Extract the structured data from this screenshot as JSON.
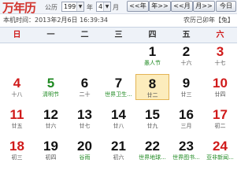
{
  "header": {
    "logo": "万年历",
    "calendar_type_label": "公历",
    "year_value": "1999",
    "year_unit": "年",
    "month_value": "4",
    "month_unit": "月",
    "prev_year_label": "<<年",
    "next_year_label": "年>>",
    "prev_month_label": "<<月",
    "next_month_label": "月>>",
    "today_label": "今日"
  },
  "info": {
    "local_time": "本机时间：2013年2月6日 16:39:34",
    "lunar_year": "农历己卯年【兔】"
  },
  "weekdays": [
    "日",
    "一",
    "二",
    "三",
    "四",
    "五",
    "六"
  ],
  "days": [
    {
      "n": "",
      "s": ""
    },
    {
      "n": "",
      "s": ""
    },
    {
      "n": "",
      "s": ""
    },
    {
      "n": "",
      "s": ""
    },
    {
      "n": "1",
      "s": "愚人节"
    },
    {
      "n": "2",
      "s": "十六"
    },
    {
      "n": "3",
      "s": "十七"
    },
    {
      "n": "4",
      "s": "十八"
    },
    {
      "n": "5",
      "s": "清明节"
    },
    {
      "n": "6",
      "s": "二十"
    },
    {
      "n": "7",
      "s": "世界卫生..."
    },
    {
      "n": "8",
      "s": "廿二"
    },
    {
      "n": "9",
      "s": "廿三"
    },
    {
      "n": "10",
      "s": "廿四"
    },
    {
      "n": "11",
      "s": "廿五"
    },
    {
      "n": "12",
      "s": "廿六"
    },
    {
      "n": "13",
      "s": "廿七"
    },
    {
      "n": "14",
      "s": "廿八"
    },
    {
      "n": "15",
      "s": "廿九"
    },
    {
      "n": "16",
      "s": "三月"
    },
    {
      "n": "17",
      "s": "初二"
    },
    {
      "n": "18",
      "s": "初三"
    },
    {
      "n": "19",
      "s": "初四"
    },
    {
      "n": "20",
      "s": "谷雨"
    },
    {
      "n": "21",
      "s": "初六"
    },
    {
      "n": "22",
      "s": "世界地球..."
    },
    {
      "n": "23",
      "s": "世界图书..."
    },
    {
      "n": "24",
      "s": "亚非新闻..."
    }
  ],
  "today_index": 11,
  "colors": {
    "weekend": "#d01a1a",
    "festival": "#1f8a22",
    "today_bg": "#fcecbc"
  }
}
